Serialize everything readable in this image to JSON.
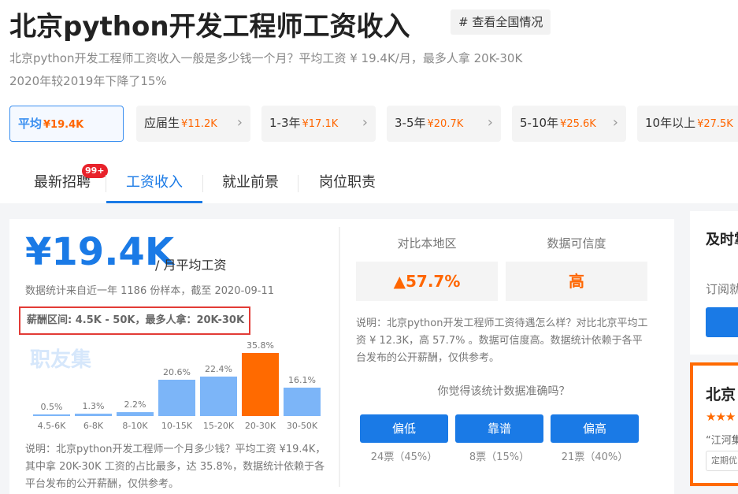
{
  "header": {
    "title": "北京python开发工程师工资收入",
    "national_button": "# 查看全国情况",
    "desc_line1": "北京python开发工程师工资收入一般是多少钱一个月？平均工资 ¥ 19.4K/月，最多人拿 20K-30K",
    "desc_line2": "2020年较2019年下降了15%"
  },
  "experience_pills": [
    {
      "label": "平均",
      "value": "¥19.4K",
      "active": true
    },
    {
      "label": "应届生",
      "value": "¥11.2K",
      "active": false
    },
    {
      "label": "1-3年",
      "value": "¥17.1K",
      "active": false
    },
    {
      "label": "3-5年",
      "value": "¥20.7K",
      "active": false
    },
    {
      "label": "5-10年",
      "value": "¥25.6K",
      "active": false
    },
    {
      "label": "10年以上",
      "value": "¥27.5K",
      "active": false
    }
  ],
  "tabs": [
    {
      "label": "最新招聘",
      "badge": "99+",
      "active": false
    },
    {
      "label": "工资收入",
      "active": true
    },
    {
      "label": "就业前景",
      "active": false
    },
    {
      "label": "岗位职责",
      "active": false
    }
  ],
  "salary": {
    "amount": "¥19.4K",
    "unit": "/ 月平均工资",
    "stat_note": "数据统计来自近一年 1186 份样本，截至 2020-09-11",
    "range_text": "薪酬区间: 4.5K - 50K，最多人拿：20K-30K",
    "watermark": "职友集",
    "chart_note": "说明：北京python开发工程师一个月多少钱？平均工资 ¥19.4K，其中拿 20K-30K 工资的占比最多，达 35.8%，数据统计依赖于各平台发布的公开薪酬，仅供参考。"
  },
  "chart_data": {
    "type": "bar",
    "categories": [
      "4.5-6K",
      "6-8K",
      "8-10K",
      "10-15K",
      "15-20K",
      "20-30K",
      "30-50K"
    ],
    "values": [
      0.5,
      1.3,
      2.2,
      20.6,
      22.4,
      35.8,
      16.1
    ],
    "labels": [
      "0.5%",
      "1.3%",
      "2.2%",
      "20.6%",
      "22.4%",
      "35.8%",
      "16.1%"
    ],
    "highlight_index": 5,
    "colors": {
      "normal": "#7cb5f8",
      "highlight": "#ff6a00"
    },
    "ylim": [
      0,
      35.8
    ],
    "title": "",
    "xlabel": "",
    "ylabel": ""
  },
  "comparison": {
    "local_label": "对比本地区",
    "local_value": "▲57.7%",
    "credibility_label": "数据可信度",
    "credibility_value": "高",
    "explanation": "说明：北京python开发工程师工资待遇怎么样？对比北京平均工资 ¥ 12.3K，高 57.7% 。数据可信度高。数据统计依赖于各平台发布的公开薪酬，仅供参考。",
    "question": "你觉得该统计数据准确吗？",
    "votes": [
      {
        "label": "偏低",
        "count": "24票（45%）"
      },
      {
        "label": "靠谱",
        "count": "8票（15%）"
      },
      {
        "label": "偏高",
        "count": "21票（40%）"
      }
    ]
  },
  "sidebar": {
    "card1_title": "及时掌",
    "card1_sub": "订阅就",
    "card2_title": "北京",
    "card2_quote": "“江河集",
    "card2_tag": "定期优"
  },
  "colors": {
    "accent": "#1a7ae6",
    "orange": "#ff6600",
    "red_border": "#e23b36"
  }
}
